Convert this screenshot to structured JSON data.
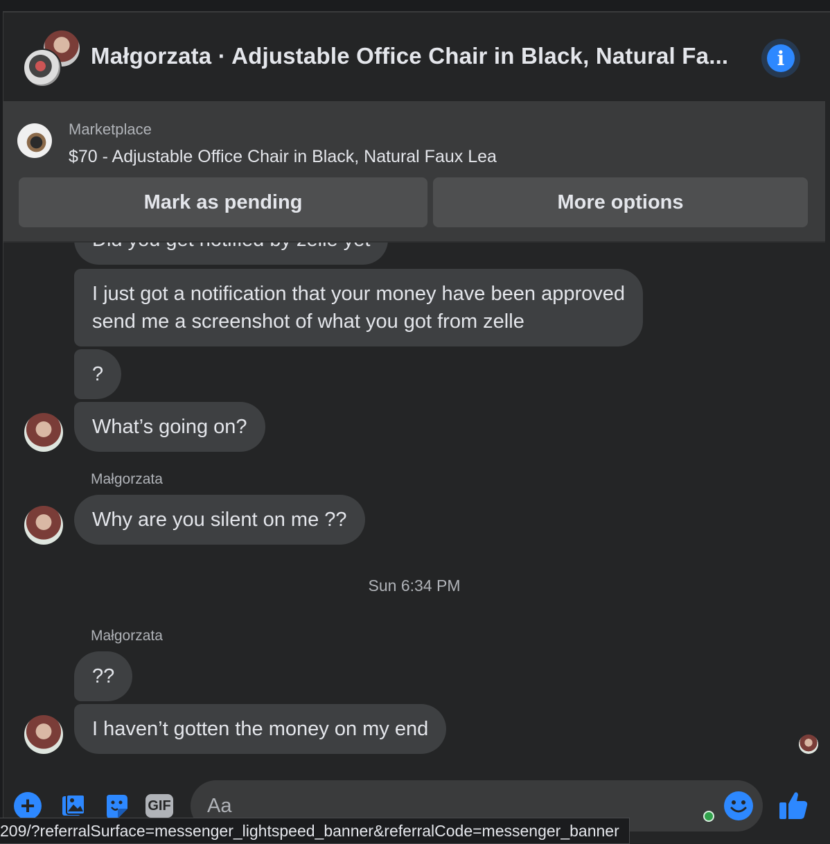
{
  "header": {
    "title": "Małgorzata · Adjustable Office Chair in Black, Natural Fa...",
    "info_icon": "info-icon"
  },
  "banner": {
    "label": "Marketplace",
    "item_title": "$70 - Adjustable Office Chair in Black, Natural Faux Lea",
    "mark_pending_label": "Mark as pending",
    "more_options_label": "More options"
  },
  "messages": [
    {
      "text": "Did you get notified by zelle yet"
    },
    {
      "text_line1": "I just got a notification that your money have been approved",
      "text_line2": "send me a screenshot of what you got from zelle"
    },
    {
      "text": "?"
    },
    {
      "text": "What’s going on?"
    },
    {
      "sender": "Małgorzata"
    },
    {
      "text": "Why are you silent on me ??"
    },
    {
      "timestamp": "Sun 6:34 PM"
    },
    {
      "sender": "Małgorzata"
    },
    {
      "text": "??"
    },
    {
      "text": "I haven’t gotten the money on my end"
    }
  ],
  "composer": {
    "placeholder": "Aa",
    "icons": [
      "plus-icon",
      "photo-icon",
      "sticker-icon",
      "gif-icon",
      "emoji-icon",
      "like-icon"
    ],
    "gif_label": "GIF"
  },
  "status_url": "209/?referralSurface=messenger_lightspeed_banner&referralCode=messenger_banner",
  "colors": {
    "accent": "#2d88ff",
    "background": "#242526",
    "bubble": "#3e4042",
    "online": "#31a24c"
  }
}
